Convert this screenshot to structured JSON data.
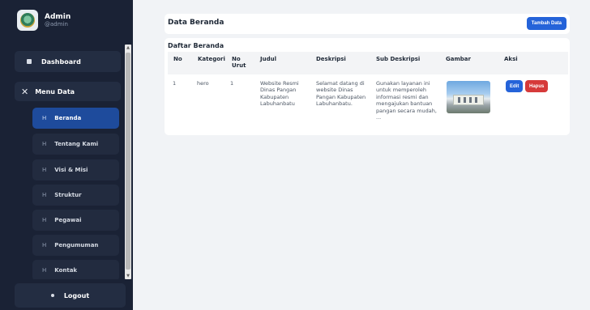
{
  "profile": {
    "name": "Admin",
    "handle": "@admin"
  },
  "sidebar": {
    "dashboard": "Dashboard",
    "menu_data": "Menu Data",
    "menu_data_icon": "close-icon",
    "sub_items": [
      {
        "label": "Beranda",
        "active": true
      },
      {
        "label": "Tentang Kami",
        "active": false
      },
      {
        "label": "Visi & Misi",
        "active": false
      },
      {
        "label": "Struktur",
        "active": false
      },
      {
        "label": "Pegawai",
        "active": false
      },
      {
        "label": "Pengumuman",
        "active": false
      },
      {
        "label": "Kontak",
        "active": false
      }
    ],
    "sub_icon_glyph": "H",
    "logout": "Logout"
  },
  "header": {
    "title": "Data Beranda",
    "add_button": "Tambah Data"
  },
  "table": {
    "title": "Daftar Beranda",
    "columns": [
      "No",
      "Kategori",
      "No Urut",
      "Judul",
      "Deskripsi",
      "Sub Deskripsi",
      "Gambar",
      "Aksi"
    ],
    "rows": [
      {
        "no": "1",
        "kategori": "hero",
        "no_urut": "1",
        "judul": "Website Resmi Dinas Pangan Kabupaten Labuhanbatu",
        "deskripsi": "Selamat datang di website Dinas Pangan Kabupaten Labuhanbatu.",
        "sub_deskripsi": "Gunakan layanan ini untuk memperoleh informasi resmi dan mengajukan bantuan pangan secara mudah, ...",
        "edit": "Edit",
        "hapus": "Hapus"
      }
    ]
  },
  "colors": {
    "sidebar": "#1a2235",
    "active": "#1e4b9c",
    "primary": "#2563d9",
    "danger": "#d63a3a"
  }
}
